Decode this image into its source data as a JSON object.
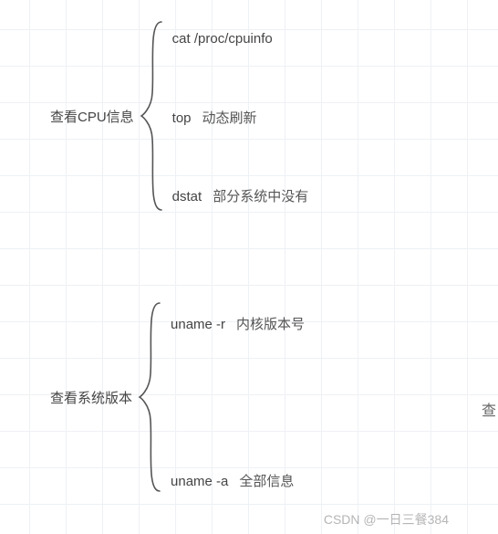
{
  "groups": [
    {
      "label": "查看CPU信息",
      "children": [
        {
          "cmd": "cat /proc/cpuinfo",
          "note": ""
        },
        {
          "cmd": "top",
          "note": "动态刷新"
        },
        {
          "cmd": "dstat",
          "note": "部分系统中没有"
        }
      ]
    },
    {
      "label": "查看系统版本",
      "children": [
        {
          "cmd": "uname -r",
          "note": "内核版本号"
        },
        {
          "cmd": "uname -a",
          "note": "全部信息"
        }
      ]
    }
  ],
  "watermark": "CSDN @一日三餐384",
  "edge_cut": "查"
}
